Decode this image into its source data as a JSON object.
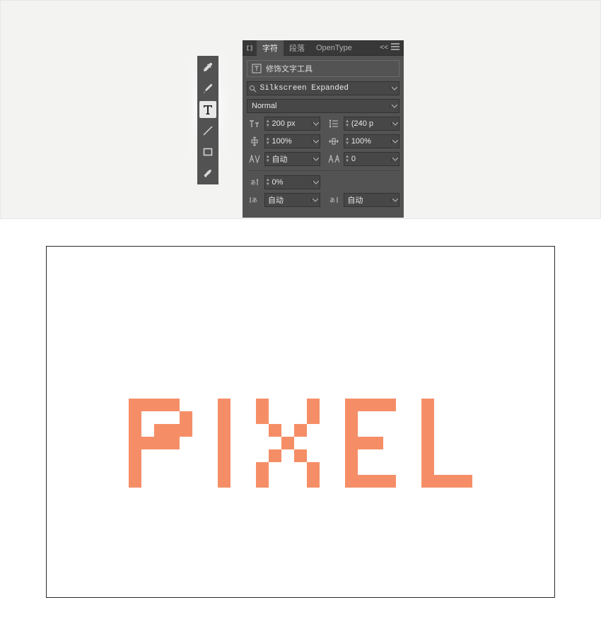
{
  "panel": {
    "tabs": {
      "char": "字符",
      "para": "段落",
      "opentype": "OpenType"
    },
    "menu_collapse": "<<",
    "touchup_label": "修饰文字工具",
    "font_family": "Silkscreen Expanded",
    "font_style": "Normal",
    "font_size": "200 px",
    "leading": "(240 p",
    "vscale": "100%",
    "hscale": "100%",
    "kerning": "自动",
    "tracking": "0",
    "shift": "0%",
    "lang_left": "自动",
    "lang_right": "自动"
  },
  "canvas": {
    "text": "PIXEL",
    "fill": "#f58e67"
  }
}
